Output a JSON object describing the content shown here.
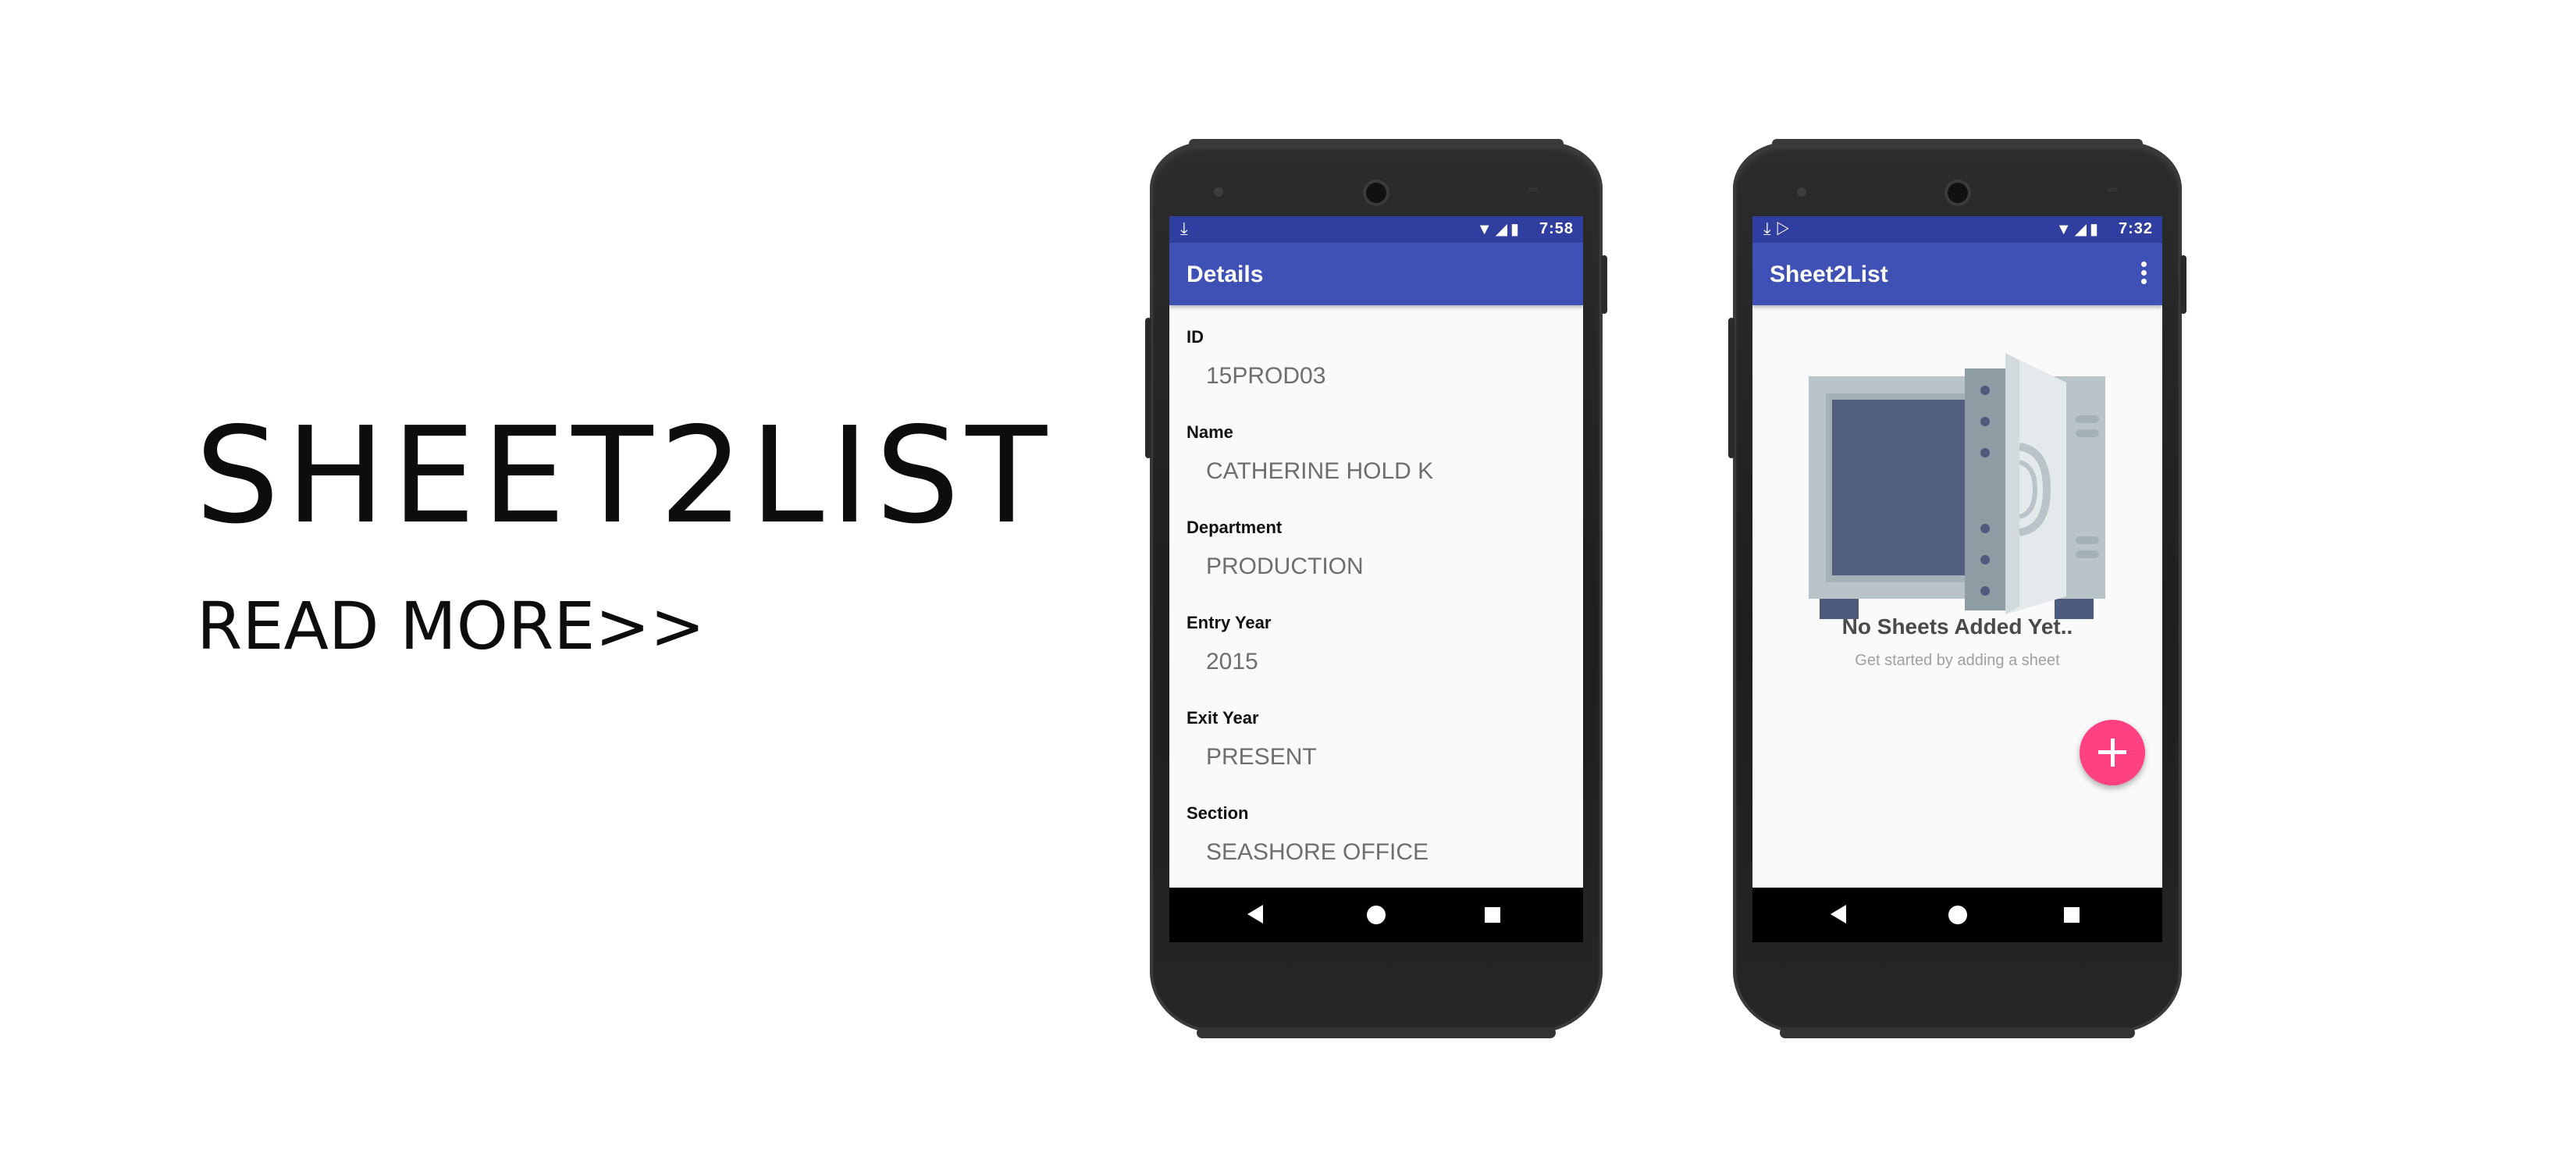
{
  "hero": {
    "title": "SHEET2LIST",
    "read_more": "READ MORE>>"
  },
  "phone_details": {
    "status_bar": {
      "time": "7:58",
      "left_icons": [
        "download-icon"
      ],
      "right_icons": [
        "wifi-icon",
        "signal-icon",
        "battery-icon"
      ]
    },
    "appbar_title": "Details",
    "fields": [
      {
        "label": "ID",
        "value": "15PROD03"
      },
      {
        "label": "Name",
        "value": "CATHERINE HOLD K"
      },
      {
        "label": "Department",
        "value": "PRODUCTION"
      },
      {
        "label": "Entry Year",
        "value": "2015"
      },
      {
        "label": "Exit Year",
        "value": "PRESENT"
      },
      {
        "label": "Section",
        "value": "SEASHORE OFFICE"
      }
    ]
  },
  "phone_list": {
    "status_bar": {
      "time": "7:32",
      "left_icons": [
        "download-icon",
        "play-store-icon"
      ],
      "right_icons": [
        "wifi-icon",
        "signal-icon",
        "battery-icon"
      ]
    },
    "appbar_title": "Sheet2List",
    "empty_title": "No Sheets Added Yet..",
    "empty_subtitle": "Get started by adding a sheet",
    "fab_icon": "plus-icon"
  },
  "colors": {
    "status_bar": "#303f9f",
    "app_bar": "#3f51b5",
    "fab": "#ff4081",
    "background": "#fafafa"
  }
}
